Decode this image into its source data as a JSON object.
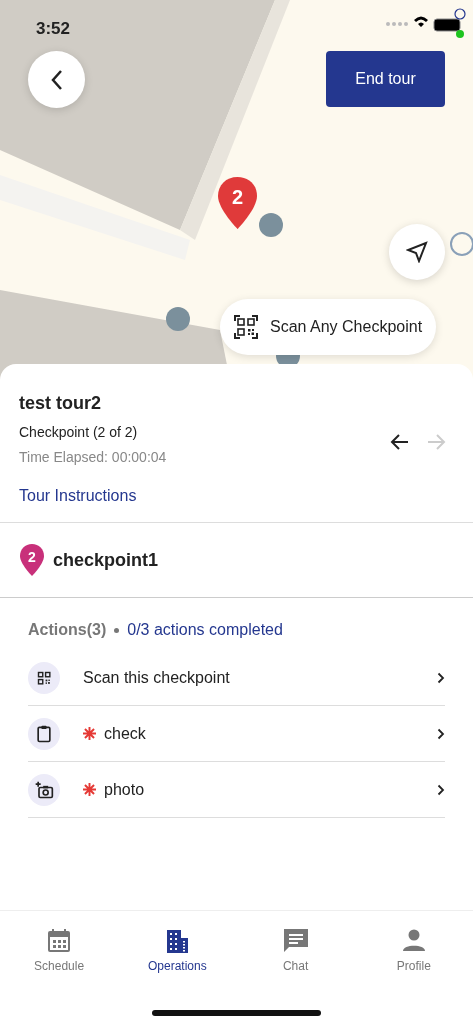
{
  "status_bar": {
    "time": "3:52"
  },
  "map": {
    "kind": "picture",
    "marker": "2"
  },
  "end_button": "End tour",
  "scan_any_button": "Scan Any Checkpoint",
  "tour": {
    "title": "test tour2",
    "checkpoint": "Checkpoint (2 of 2)",
    "elapsed": "Time Elapsed: 00:00:04",
    "instructions_link": "Tour Instructions",
    "prev_disabled": false,
    "next_disabled": true
  },
  "checkpoint": {
    "number": "2",
    "name": "checkpoint1"
  },
  "actions": {
    "title": "Actions(3)",
    "progress": "0/3 actions completed",
    "items": [
      {
        "kind": "scan",
        "label": "Scan this checkpoint",
        "required": false
      },
      {
        "kind": "check",
        "label": "check",
        "required": true
      },
      {
        "label": "photo",
        "required": true
      }
    ]
  },
  "tabs": [
    {
      "kind": "schedule",
      "label": "Schedule",
      "selected": false
    },
    {
      "kind": "operations",
      "label": "Operations",
      "selected": true
    },
    {
      "kind": "chat",
      "label": "Chat",
      "selected": false
    },
    {
      "kind": "profile",
      "label": "Profile",
      "selected": false
    }
  ]
}
